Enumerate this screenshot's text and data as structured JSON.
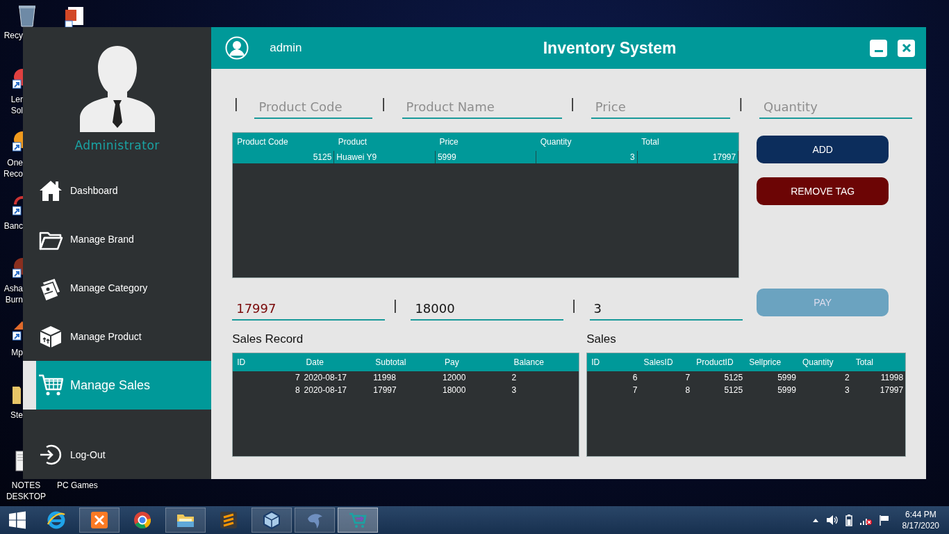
{
  "desktop_icons": [
    {
      "kind": "recycle-bin",
      "lines": [
        "Recy"
      ]
    },
    {
      "kind": "presentation"
    },
    {
      "kind": "shortcut-red",
      "lines": [
        "Ler",
        "Sol"
      ]
    },
    {
      "kind": "shortcut-orange",
      "lines": [
        "One",
        "Reco"
      ]
    },
    {
      "kind": "shortcut-lock",
      "lines": [
        "Banc"
      ]
    },
    {
      "kind": "shortcut-disc",
      "lines": [
        "Asha",
        "Burn"
      ]
    },
    {
      "kind": "shortcut-media",
      "lines": [
        "Mp"
      ]
    },
    {
      "kind": "folder",
      "lines": [
        "Ste"
      ]
    },
    {
      "kind": "notes",
      "lines": [
        "NOTES",
        "DESKTOP"
      ]
    },
    {
      "kind": "label-only",
      "lines": [
        "PC Games"
      ]
    }
  ],
  "window": {
    "user": "admin",
    "title": "Inventory System"
  },
  "sidebar": {
    "role": "Administrator",
    "items": [
      {
        "kind": "home",
        "label": "Dashboard",
        "selected": false
      },
      {
        "kind": "folder",
        "label": "Manage Brand",
        "selected": false
      },
      {
        "kind": "documents",
        "label": "Manage Category",
        "selected": false
      },
      {
        "kind": "box",
        "label": "Manage Product",
        "selected": false
      },
      {
        "kind": "cart",
        "label": "Manage Sales",
        "selected": true
      },
      {
        "kind": "logout",
        "label": "Log-Out",
        "selected": false
      }
    ]
  },
  "entry_fields": [
    {
      "prefix": "|",
      "placeholder": "Product Code"
    },
    {
      "prefix": "|",
      "placeholder": "Product Name"
    },
    {
      "prefix": "|",
      "placeholder": "Price"
    },
    {
      "prefix": "|",
      "placeholder": "Quantity"
    }
  ],
  "cart_table": {
    "columns": [
      "Product Code",
      "Product",
      "Price",
      "Quantity",
      "Total"
    ],
    "rows": [
      {
        "selected": true,
        "cells": [
          "5125",
          "Huawei Y9",
          "5999",
          "3",
          "17997"
        ]
      }
    ]
  },
  "buttons": [
    {
      "kind": "add",
      "label": "ADD",
      "disabled": false
    },
    {
      "kind": "remove",
      "label": "REMOVE TAG",
      "disabled": false
    },
    {
      "kind": "add",
      "label": "PAY",
      "disabled": true
    }
  ],
  "payment_fields": [
    {
      "kind": "total",
      "value": "17997"
    },
    {
      "kind": "amount",
      "prefix": "|",
      "value": "18000"
    },
    {
      "kind": "amount",
      "prefix": "|",
      "value": "3"
    }
  ],
  "sales_record": {
    "title": "Sales Record",
    "columns": [
      "ID",
      "Date",
      "Subtotal",
      "Pay",
      "Balance"
    ],
    "rows": [
      [
        "7",
        "2020-08-17",
        "11998",
        "12000",
        "2"
      ],
      [
        "8",
        "2020-08-17",
        "17997",
        "18000",
        "3"
      ]
    ]
  },
  "sales": {
    "title": "Sales",
    "columns": [
      "ID",
      "SalesID",
      "ProductID",
      "Sellprice",
      "Quantity",
      "Total"
    ],
    "rows": [
      [
        "6",
        "7",
        "5125",
        "5999",
        "2",
        "11998"
      ],
      [
        "7",
        "8",
        "5125",
        "5999",
        "3",
        "17997"
      ]
    ]
  },
  "taskbar": {
    "apps": [
      {
        "kind": "ring",
        "running": false,
        "selected": false
      },
      {
        "kind": "square-logo",
        "running": true,
        "selected": false
      },
      {
        "kind": "segmented-circle",
        "running": false,
        "selected": false
      },
      {
        "kind": "folder",
        "running": true,
        "selected": false
      },
      {
        "kind": "stripes",
        "running": false,
        "selected": false
      },
      {
        "kind": "cube",
        "running": true,
        "selected": false
      },
      {
        "kind": "dolphin",
        "running": true,
        "selected": false
      },
      {
        "kind": "cart",
        "running": true,
        "selected": true
      }
    ],
    "time": "6:44 PM",
    "date": "8/17/2020"
  }
}
